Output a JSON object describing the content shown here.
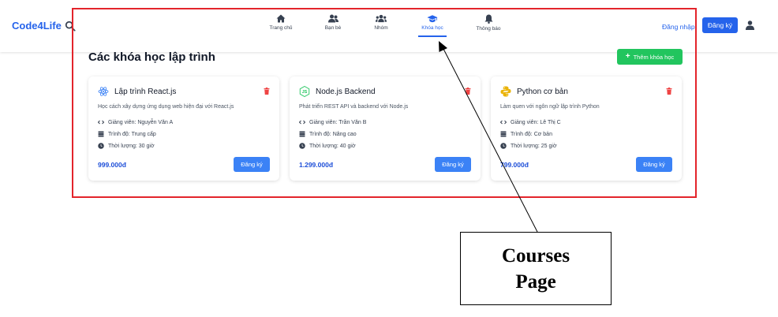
{
  "navbar": {
    "brand": "Code4Life",
    "items": [
      {
        "label": "Trang chủ",
        "icon": "home-icon",
        "active": false
      },
      {
        "label": "Bạn bè",
        "icon": "friends-icon",
        "active": false
      },
      {
        "label": "Nhóm",
        "icon": "group-icon",
        "active": false
      },
      {
        "label": "Khóa học",
        "icon": "graduation-cap-icon",
        "active": true
      },
      {
        "label": "Thông báo",
        "icon": "bell-icon",
        "active": false
      }
    ],
    "login_label": "Đăng nhập",
    "register_label": "Đăng ký"
  },
  "page": {
    "title": "Các khóa học lập trình",
    "add_button_label": "Thêm khóa học"
  },
  "courses": [
    {
      "title": "Lập trình React.js",
      "logo": "react-logo-icon",
      "description": "Học cách xây dựng ứng dụng web hiện đại với React.js",
      "instructor": "Giảng viên: Nguyễn Văn A",
      "level": "Trình độ: Trung cấp",
      "duration": "Thời lượng: 30 giờ",
      "price": "999.000đ",
      "button_label": "Đăng ký"
    },
    {
      "title": "Node.js Backend",
      "logo": "nodejs-logo-icon",
      "description": "Phát triển REST API và backend với Node.js",
      "instructor": "Giảng viên: Trần Văn B",
      "level": "Trình độ: Nâng cao",
      "duration": "Thời lượng: 40 giờ",
      "price": "1.299.000đ",
      "button_label": "Đăng ký"
    },
    {
      "title": "Python cơ bản",
      "logo": "python-logo-icon",
      "description": "Làm quen với ngôn ngữ lập trình Python",
      "instructor": "Giảng viên: Lê Thị C",
      "level": "Trình độ: Cơ bản",
      "duration": "Thời lượng: 25 giờ",
      "price": "799.000đ",
      "button_label": "Đăng ký"
    }
  ],
  "annotation": {
    "line1": "Courses",
    "line2": "Page"
  },
  "colors": {
    "primary": "#2563eb",
    "success": "#22c55e",
    "danger": "#ef4444",
    "annotation_box": "#e3242b"
  }
}
